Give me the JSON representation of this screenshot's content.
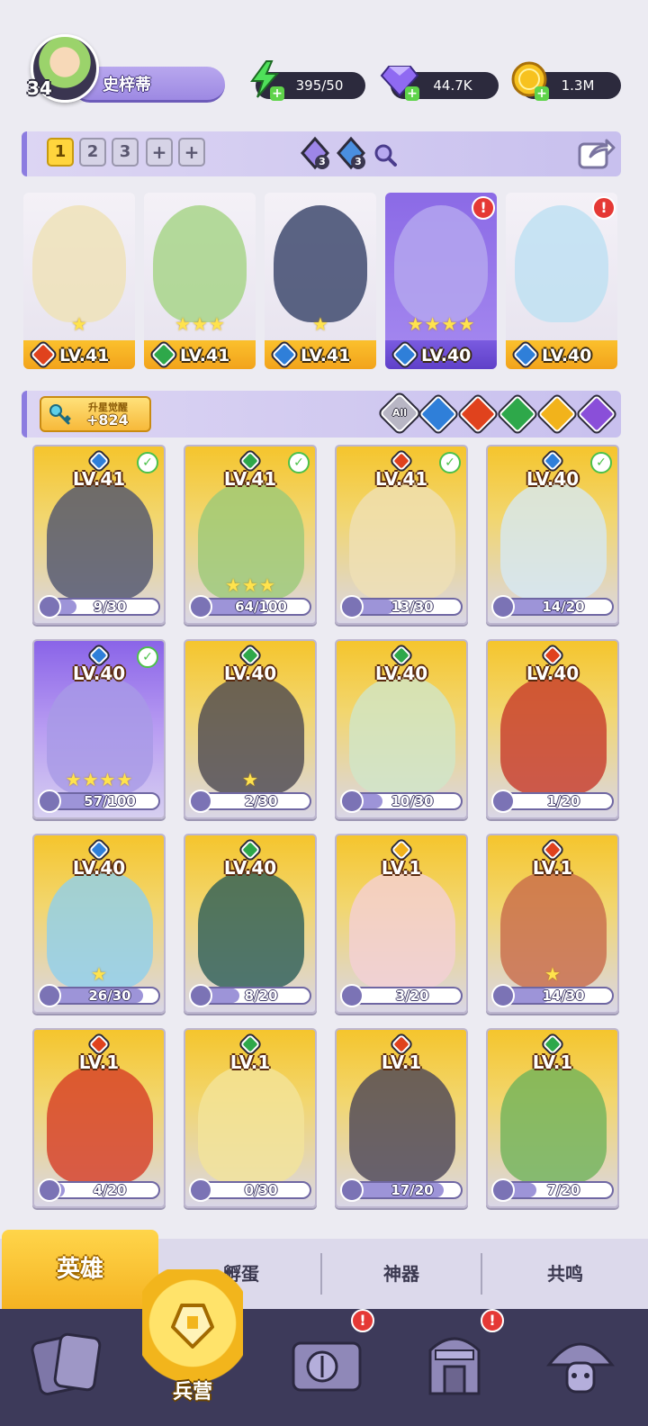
{
  "player": {
    "level": "34",
    "name": "史梓蒂"
  },
  "resources": {
    "energy": "395/50",
    "gems": "44.7K",
    "gold": "1.3M"
  },
  "team_tabs": [
    "1",
    "2",
    "3",
    "+",
    "+"
  ],
  "crystals": [
    {
      "count": "3",
      "color": "#9d86e8"
    },
    {
      "count": "3",
      "color": "#4a8fe0"
    }
  ],
  "deck": [
    {
      "level": "LV.41",
      "element": "fire",
      "stars": 1,
      "art": "#efe2b8",
      "selected": false,
      "alert": false
    },
    {
      "level": "LV.41",
      "element": "nature",
      "stars": 3,
      "art": "#a8d58a",
      "selected": false,
      "alert": false
    },
    {
      "level": "LV.41",
      "element": "water",
      "stars": 1,
      "art": "#3f4a6e",
      "selected": false,
      "alert": false
    },
    {
      "level": "LV.40",
      "element": "water",
      "stars": 4,
      "art": "#b4a6ee",
      "selected": true,
      "alert": true
    },
    {
      "level": "LV.40",
      "element": "water",
      "stars": 0,
      "art": "#bfe0f2",
      "selected": false,
      "alert": true
    }
  ],
  "awaken": {
    "title": "升星觉醒",
    "count": "+824"
  },
  "filter": {
    "all_label": "All",
    "elements": [
      "water",
      "fire",
      "nature",
      "light",
      "dark"
    ]
  },
  "element_colors": {
    "fire": "#e0421d",
    "water": "#2f7fd9",
    "nature": "#2ea84a",
    "light": "#f2b31b",
    "dark": "#8a4fd9"
  },
  "heroes": [
    {
      "level": "LV.41",
      "element": "water",
      "stars": 0,
      "shards": "9/30",
      "progress": 0.3,
      "check": true,
      "art": "#4d536e",
      "purple": false
    },
    {
      "level": "LV.41",
      "element": "nature",
      "stars": 3,
      "shards": "64/100",
      "progress": 0.64,
      "check": true,
      "art": "#9bc978",
      "purple": false
    },
    {
      "level": "LV.41",
      "element": "fire",
      "stars": 0,
      "shards": "13/30",
      "progress": 0.43,
      "check": true,
      "art": "#efe0b5",
      "purple": false
    },
    {
      "level": "LV.40",
      "element": "water",
      "stars": 0,
      "shards": "14/20",
      "progress": 0.7,
      "check": true,
      "art": "#d6e8f4",
      "purple": false
    },
    {
      "level": "LV.40",
      "element": "water",
      "stars": 4,
      "shards": "57/100",
      "progress": 0.57,
      "check": true,
      "art": "#a89ae6",
      "purple": true
    },
    {
      "level": "LV.40",
      "element": "nature",
      "stars": 1,
      "shards": "2/30",
      "progress": 0.07,
      "check": false,
      "art": "#4b4750",
      "purple": false
    },
    {
      "level": "LV.40",
      "element": "nature",
      "stars": 0,
      "shards": "10/30",
      "progress": 0.33,
      "check": false,
      "art": "#cfe6c8",
      "purple": false
    },
    {
      "level": "LV.40",
      "element": "fire",
      "stars": 0,
      "shards": "1/20",
      "progress": 0.05,
      "check": false,
      "art": "#c73a2a",
      "purple": false
    },
    {
      "level": "LV.40",
      "element": "water",
      "stars": 1,
      "shards": "26/30",
      "progress": 0.87,
      "check": false,
      "art": "#8fd0ee",
      "purple": false
    },
    {
      "level": "LV.40",
      "element": "nature",
      "stars": 0,
      "shards": "8/20",
      "progress": 0.4,
      "check": false,
      "art": "#2a5c58",
      "purple": false
    },
    {
      "level": "LV.1",
      "element": "light",
      "stars": 0,
      "shards": "3/20",
      "progress": 0.15,
      "check": false,
      "art": "#f4cfd6",
      "purple": false
    },
    {
      "level": "LV.1",
      "element": "fire",
      "stars": 1,
      "shards": "14/30",
      "progress": 0.47,
      "check": false,
      "art": "#c86a4a",
      "purple": false
    },
    {
      "level": "LV.1",
      "element": "fire",
      "stars": 0,
      "shards": "4/20",
      "progress": 0.2,
      "check": false,
      "art": "#d63c25",
      "purple": false
    },
    {
      "level": "LV.1",
      "element": "nature",
      "stars": 0,
      "shards": "0/30",
      "progress": 0.0,
      "check": false,
      "art": "#f3e49a",
      "purple": false
    },
    {
      "level": "LV.1",
      "element": "fire",
      "stars": 0,
      "shards": "17/20",
      "progress": 0.85,
      "check": false,
      "art": "#4a4456",
      "purple": false
    },
    {
      "level": "LV.1",
      "element": "nature",
      "stars": 0,
      "shards": "7/20",
      "progress": 0.35,
      "check": false,
      "art": "#6fb35a",
      "purple": false
    }
  ],
  "subtabs": {
    "heroes": "英雄",
    "eggs": "孵蛋",
    "artifacts": "神器",
    "resonance": "共鸣"
  },
  "nav": {
    "barracks": "兵营"
  }
}
